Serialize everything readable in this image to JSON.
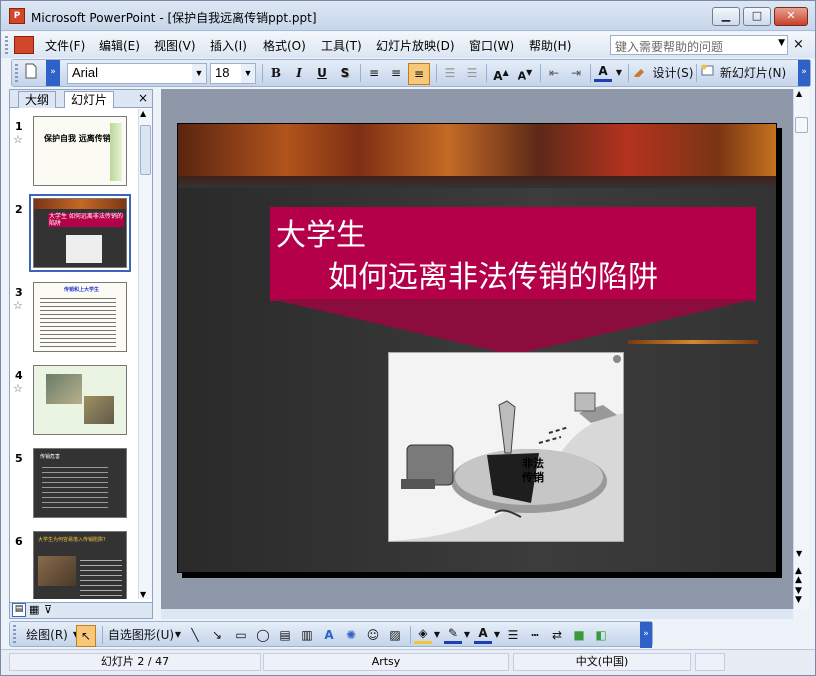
{
  "window": {
    "title": "Microsoft PowerPoint - [保护自我远离传销ppt.ppt]",
    "app_icon_text": "P",
    "controls": {
      "minimize": "▁",
      "maximize": "□",
      "close": "✕"
    }
  },
  "menu": {
    "items": [
      "文件(F)",
      "编辑(E)",
      "视图(V)",
      "插入(I)",
      "格式(O)",
      "工具(T)",
      "幻灯片放映(D)",
      "窗口(W)",
      "帮助(H)"
    ],
    "help_placeholder": "键入需要帮助的问题",
    "close": "×"
  },
  "toolbar": {
    "font": "Arial",
    "size": "18",
    "bold": "B",
    "italic": "I",
    "underline": "U",
    "shadow": "S",
    "design_label": "设计(S)",
    "new_slide_label": "新幻灯片(N)",
    "font_color_glyph": "A"
  },
  "left_pane": {
    "tabs": [
      "大纲",
      "幻灯片"
    ],
    "active_tab": "幻灯片",
    "close": "×",
    "thumbnails": [
      {
        "num": "1",
        "star": true,
        "title": "保护自我 远离传销"
      },
      {
        "num": "2",
        "star": false,
        "title": "大学生 如何远离非法传销的陷阱",
        "selected": true
      },
      {
        "num": "3",
        "star": true,
        "title": "传销和上大学生"
      },
      {
        "num": "4",
        "star": true,
        "title": ""
      },
      {
        "num": "5",
        "star": false,
        "title": "传销危害"
      },
      {
        "num": "6",
        "star": false,
        "title": "大学生为何容易落入传销陷阱?"
      }
    ]
  },
  "slide": {
    "title_line1": "大学生",
    "title_line2": "如何远离非法传销的陷阱",
    "cartoon_text": "非法传销"
  },
  "drawing": {
    "draw_label": "绘图(R)",
    "autoshapes_label": "自选图形(U)"
  },
  "status": {
    "slide_info": "幻灯片 2 / 47",
    "design": "Artsy",
    "language": "中文(中国)"
  }
}
